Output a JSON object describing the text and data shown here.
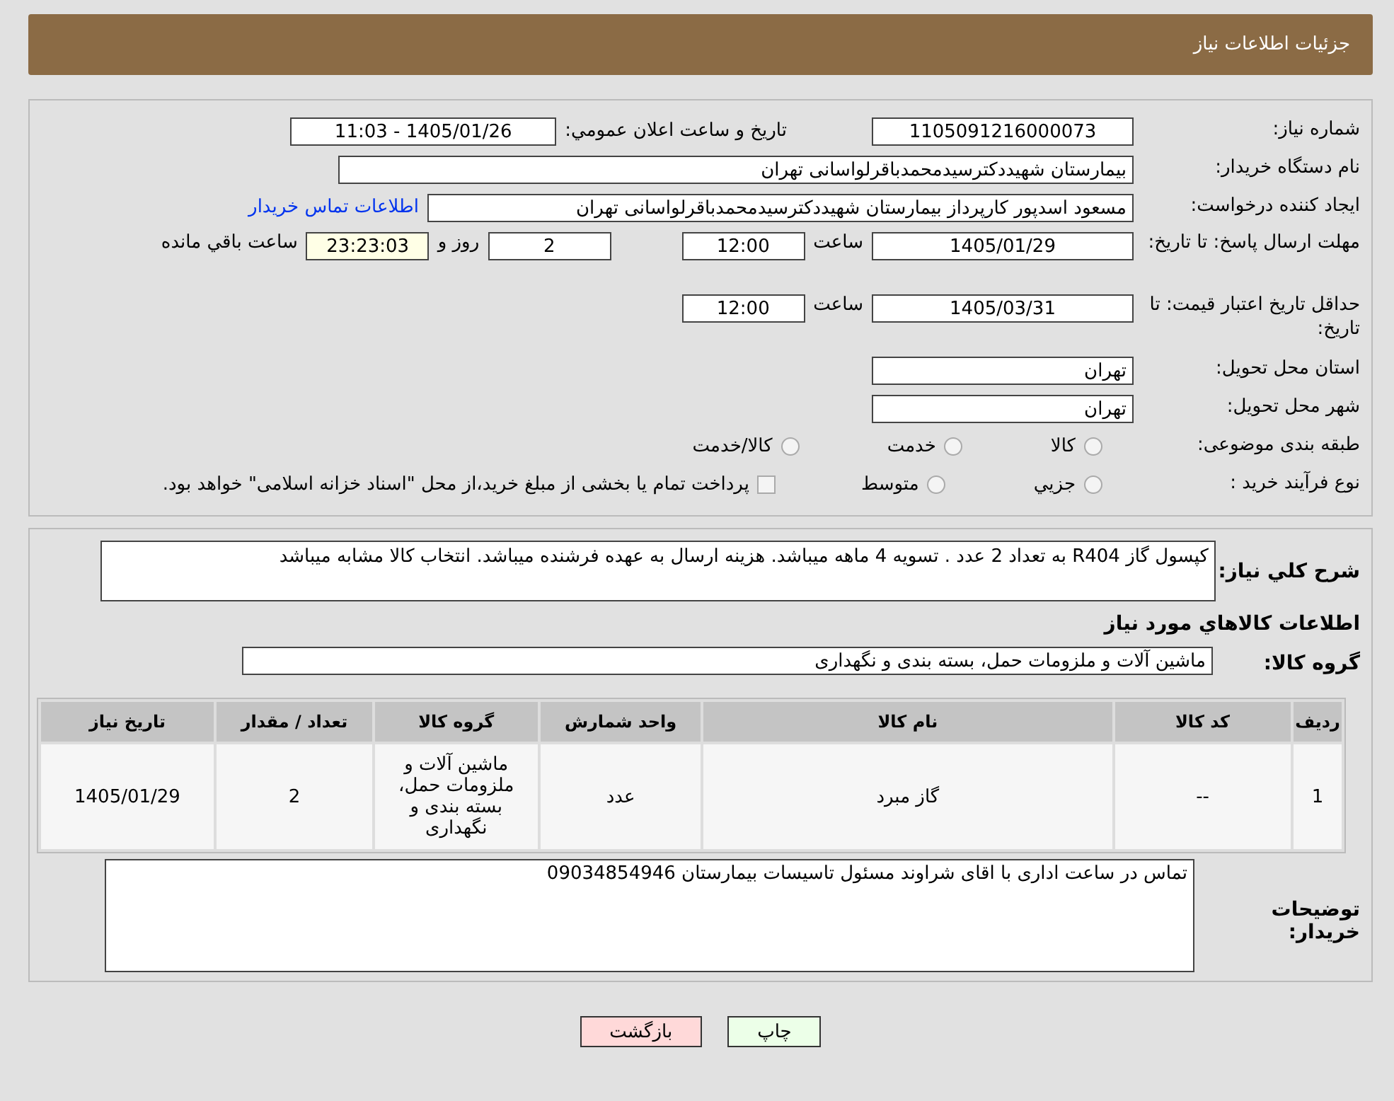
{
  "header": {
    "title": "جزئیات اطلاعات نیاز"
  },
  "need_number": {
    "label": "شماره نیاز:",
    "value": "1105091216000073"
  },
  "announce": {
    "label": "تاريخ و ساعت اعلان عمومي:",
    "value": "1405/01/26 - 11:03"
  },
  "buyer": {
    "label": "نام دستگاه خريدار:",
    "value": "بيمارستان شهيددکترسيدمحمدباقرلواسانی تهران"
  },
  "requester": {
    "label": "ايجاد کننده درخواست:",
    "value": "مسعود اسدپور کارپرداز بيمارستان شهيددکترسيدمحمدباقرلواسانی تهران",
    "link": "اطلاعات تماس خريدار"
  },
  "deadline": {
    "label": "مهلت ارسال پاسخ: تا تاریخ:",
    "date": "1405/01/29",
    "time_label": "ساعت",
    "time": "12:00",
    "days": "2",
    "days_label": "روز و",
    "remaining": "23:23:03",
    "remaining_label": "ساعت باقي مانده"
  },
  "validity": {
    "label": "حداقل تاريخ اعتبار قيمت: تا تاریخ:",
    "date": "1405/03/31",
    "time_label": "ساعت",
    "time": "12:00"
  },
  "province": {
    "label": "استان محل تحويل:",
    "value": "تهران"
  },
  "city": {
    "label": "شهر محل تحويل:",
    "value": "تهران"
  },
  "category": {
    "label": "طبقه بندی موضوعی:",
    "options": [
      {
        "label": "کالا",
        "selected": false
      },
      {
        "label": "خدمت",
        "selected": false
      },
      {
        "label": "کالا/خدمت",
        "selected": false
      }
    ]
  },
  "process": {
    "label": "نوع فرآيند خريد :",
    "options": [
      {
        "label": "جزيي",
        "selected": false
      },
      {
        "label": "متوسط",
        "selected": false
      }
    ],
    "note_checked": false,
    "note": "پرداخت تمام يا بخشی از مبلغ خريد،از محل \"اسناد خزانه اسلامی\" خواهد بود."
  },
  "description": {
    "label": "شرح کلي نياز:",
    "value": "کپسول گاز R404 به تعداد 2 عدد . تسویه 4 ماهه میباشد. هزینه ارسال به عهده فرشنده میباشد. انتخاب کالا مشابه میباشد"
  },
  "goods_heading": "اطلاعات كالاهاي مورد نياز",
  "goods_group": {
    "label": "گروه کالا:",
    "value": "ماشين آلات و ملزومات حمل، بسته بندی و نگهداری"
  },
  "table": {
    "columns": [
      "رديف",
      "کد کالا",
      "نام کالا",
      "واحد شمارش",
      "گروه کالا",
      "تعداد / مقدار",
      "تاريخ نياز"
    ],
    "rows": [
      [
        "1",
        "--",
        "گاز مبرد",
        "عدد",
        "ماشين آلات و ملزومات حمل، بسته بندی و نگهداری",
        "2",
        "1405/01/29"
      ]
    ]
  },
  "notes": {
    "label": "توضیحات خریدار:",
    "value": "تماس در ساعت اداری با اقای شراوند مسئول تاسیسات بیمارستان 09034854946"
  },
  "buttons": {
    "print": "چاپ",
    "back": "بازگشت"
  }
}
